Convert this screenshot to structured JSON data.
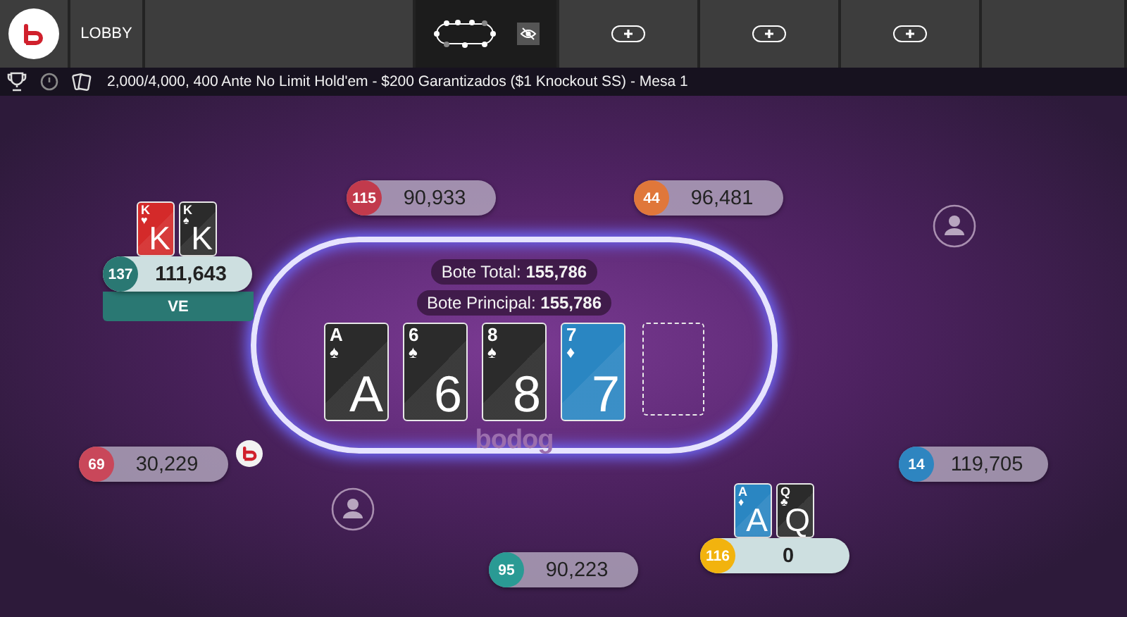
{
  "top_bar": {
    "tabs": [
      {
        "kind": "logo",
        "selected": false
      },
      {
        "kind": "label",
        "label": "LOBBY",
        "selected": false
      },
      {
        "kind": "empty",
        "selected": false
      },
      {
        "kind": "table",
        "selected": true
      },
      {
        "kind": "add",
        "selected": false
      },
      {
        "kind": "add",
        "selected": false
      },
      {
        "kind": "add",
        "selected": false
      },
      {
        "kind": "empty",
        "selected": false
      }
    ]
  },
  "info_bar": {
    "title": "2,000/4,000, 400 Ante No Limit Hold'em - $200 Garantizados ($1 Knockout SS) - Mesa 1"
  },
  "table": {
    "pots": [
      "Bote Total: **155,786**",
      "Bote Principal: **155,786**"
    ],
    "board": [
      {
        "kind": "card",
        "corner": "A",
        "rank": "A",
        "suit": "♠",
        "color": "#2b2b2b"
      },
      {
        "kind": "card",
        "corner": "6",
        "rank": "6",
        "suit": "♠",
        "color": "#2b2b2b"
      },
      {
        "kind": "card",
        "corner": "8",
        "rank": "8",
        "suit": "♠",
        "color": "#2b2b2b"
      },
      {
        "kind": "card",
        "corner": "7",
        "rank": "7",
        "suit": "♦",
        "color": "#2a86c2"
      },
      {
        "kind": "empty"
      }
    ],
    "brand": "bodog"
  },
  "seats": [
    {
      "kind": "player",
      "badge": "115",
      "color": "#c23a4c",
      "stack": "90,933",
      "active": false
    },
    {
      "kind": "player",
      "badge": "44",
      "color": "#e0773a",
      "stack": "96,481",
      "active": false
    },
    {
      "kind": "empty"
    },
    {
      "kind": "player",
      "badge": "137",
      "color": "#2a7873",
      "stack": "111,643",
      "active": true,
      "tag": "VE",
      "cards": [
        {
          "corner": "K",
          "rank": "K",
          "suit": "♥",
          "color": "#d42a2a"
        },
        {
          "corner": "K",
          "rank": "K",
          "suit": "♠",
          "color": "#2b2b2b"
        }
      ]
    },
    {
      "kind": "player",
      "badge": "69",
      "color": "#c9475a",
      "stack": "30,229",
      "active": false,
      "dealer": true
    },
    {
      "kind": "player",
      "badge": "14",
      "color": "#2e85c0",
      "stack": "119,705",
      "active": false
    },
    {
      "kind": "empty"
    },
    {
      "kind": "player",
      "badge": "116",
      "color": "#f2b30e",
      "stack": "0",
      "active": true,
      "cards": [
        {
          "corner": "A",
          "rank": "A",
          "suit": "♦",
          "color": "#2a86c2"
        },
        {
          "corner": "Q",
          "rank": "Q",
          "suit": "♣",
          "color": "#2b2b2b"
        }
      ]
    },
    {
      "kind": "player",
      "badge": "95",
      "color": "#2a9a94",
      "stack": "90,223",
      "active": false
    }
  ]
}
